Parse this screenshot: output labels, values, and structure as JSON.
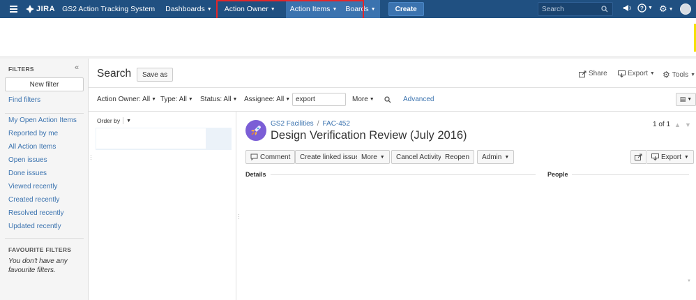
{
  "topnav": {
    "logo": "JIRA",
    "app_name": "GS2 Action Tracking System",
    "items": [
      {
        "label": "Dashboards"
      },
      {
        "label": "Action Owner"
      },
      {
        "label": "Action Items"
      },
      {
        "label": "Boards"
      }
    ],
    "create_label": "Create",
    "search_placeholder": "Search"
  },
  "sidebar": {
    "header": "FILTERS",
    "collapse_glyph": "«",
    "new_filter": "New filter",
    "find_filters": "Find filters",
    "links": [
      "My Open Action Items",
      "Reported by me",
      "All Action Items",
      "Open issues",
      "Done issues",
      "Viewed recently",
      "Created recently",
      "Resolved recently",
      "Updated recently"
    ],
    "favourites_header": "FAVOURITE FILTERS",
    "favourites_text": "You don't have any favourite filters."
  },
  "search": {
    "title": "Search",
    "save_as": "Save as",
    "share": "Share",
    "export": "Export",
    "tools": "Tools"
  },
  "filters": {
    "action_owner": "Action Owner: All",
    "type": "Type: All",
    "status": "Status: All",
    "assignee": "Assignee: All",
    "query": "export",
    "more": "More",
    "advanced": "Advanced"
  },
  "list": {
    "order_by": "Order by"
  },
  "issue": {
    "project": "GS2 Facilities",
    "key": "FAC-452",
    "title": "Design Verification Review (July 2016)",
    "pager": "1 of 1",
    "buttons": {
      "comment": "Comment",
      "create_linked": "Create linked issue",
      "more": "More",
      "cancel_activity": "Cancel Activity",
      "reopen": "Reopen",
      "admin": "Admin",
      "export": "Export"
    },
    "details_header": "Details",
    "people_header": "People"
  },
  "colors": {
    "header_bg": "#205081",
    "link": "#3b73af",
    "highlight": "#e3262a"
  }
}
